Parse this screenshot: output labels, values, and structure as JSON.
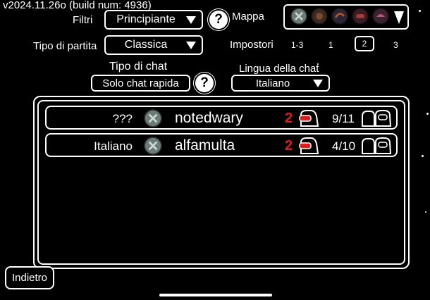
{
  "version": "v2024.11.26o (build num: 4936)",
  "filters": {
    "label": "Filtri",
    "value": "Principiante"
  },
  "map": {
    "label": "Mappa",
    "icons": [
      "map-skeld-icon",
      "map-mira-icon",
      "map-polus-icon",
      "map-airship-icon",
      "map-fungle-icon"
    ]
  },
  "game_type": {
    "label": "Tipo di partita",
    "value": "Classica"
  },
  "impostors": {
    "label": "Impostori",
    "options": [
      "1-3",
      "1",
      "2",
      "3"
    ],
    "selected": "2"
  },
  "chat_type": {
    "label": "Tipo di chat",
    "value": "Solo chat rapida"
  },
  "chat_language": {
    "label": "Lingua della chat",
    "value": "Italiano"
  },
  "help_glyph": "?",
  "lobbies": [
    {
      "language": "???",
      "map_icon": "map-skeld-icon",
      "host": "notedwary",
      "impostors": "2",
      "players": "9/11"
    },
    {
      "language": "Italiano",
      "map_icon": "map-skeld-icon",
      "host": "alfamulta",
      "impostors": "2",
      "players": "4/10"
    }
  ],
  "back_button": "Indietro",
  "colors": {
    "background": "#000000",
    "foreground": "#ffffff",
    "impostor_red": "#e21b1b"
  }
}
